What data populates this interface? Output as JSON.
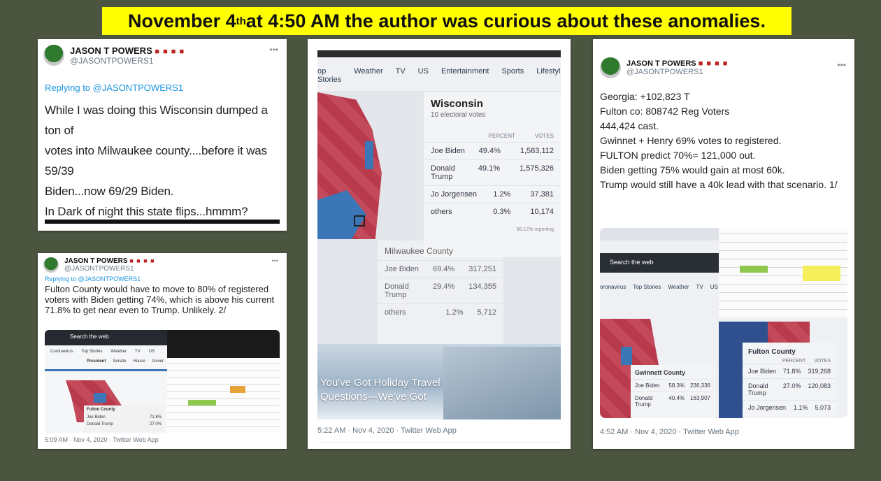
{
  "banner": {
    "pre": "November 4",
    "sup": "th",
    "post": " at 4:50 AM the author was curious about these anomalies."
  },
  "tweet1": {
    "name": "JASON T POWERS",
    "flags": "■ ■ ■ ■",
    "handle": "@JASONTPOWERS1",
    "replying_prefix": "Replying to ",
    "replying_handle": "@JASONTPOWERS1",
    "text_lines": [
      "While I was doing this Wisconsin dumped a ton of",
      "votes into Milwaukee county....before it was 59/39",
      "Biden...now 69/29 Biden.",
      "In Dark of night this state flips...hmmm?"
    ]
  },
  "tweet2": {
    "name": "JASON T POWERS",
    "flags": "■ ■ ■ ■",
    "handle": "@JASONTPOWERS1",
    "replying_prefix": "Replying to ",
    "replying_handle": "@JASONTPOWERS1",
    "text": "Fulton County would have to move to 80% of registered voters with Biden getting 74%, which is above his current 71.8% to get near even to Trump. Unlikely. 2/",
    "meta": "5:09 AM · Nov 4, 2020 · Twitter Web App",
    "shot": {
      "search": "Search the web",
      "nav": [
        "Coronavirus",
        "Top Stories",
        "Weather",
        "TV",
        "US"
      ],
      "subnav": [
        "President",
        "Senate",
        "House",
        "Gover"
      ],
      "fulton": "Fulton County",
      "rows": [
        [
          "Joe Biden",
          "71.8%"
        ],
        [
          "Donald Trump",
          "27.0%"
        ]
      ]
    }
  },
  "tweet3": {
    "meta": "5:22 AM · Nov 4, 2020 · Twitter Web App",
    "nav": [
      "op Stories",
      "Weather",
      "TV",
      "US",
      "Entertainment",
      "Sports",
      "Lifestyle"
    ],
    "state": "Wisconsin",
    "electoral": "10 electoral votes",
    "col_percent": "PERCENT",
    "col_votes": "VOTES",
    "rows": [
      [
        "Joe Biden",
        "49.4%",
        "1,583,112"
      ],
      [
        "Donald Trump",
        "49.1%",
        "1,575,326"
      ],
      [
        "Jo Jorgensen",
        "1.2%",
        "37,381"
      ],
      [
        "others",
        "0.3%",
        "10,174"
      ]
    ],
    "reporting": "96.12% reporting",
    "county": "Milwaukee County",
    "county_rows": [
      [
        "Joe Biden",
        "69.4%",
        "317,251"
      ],
      [
        "Donald Trump",
        "29.4%",
        "134,355"
      ],
      [
        "others",
        "1.2%",
        "5,712"
      ]
    ],
    "promo": [
      "You've Got Holiday Travel",
      "Questions—We've Got"
    ]
  },
  "tweet4": {
    "name": "JASON T POWERS",
    "flags": "■ ■ ■ ■",
    "handle": "@JASONTPOWERS1",
    "lines": [
      "Georgia: +102,823 T",
      "Fulton co: 808742 Reg Voters",
      "444,424 cast.",
      "Gwinnet + Henry 69% votes to registered.",
      "FULTON predict 70%= 121,000 out.",
      "Biden getting 75% would gain at most 60k.",
      "Trump would still have a 40k lead with that scenario. 1/"
    ],
    "meta": "4:52 AM · Nov 4, 2020 · Twitter Web App",
    "shot": {
      "search": "Search the web",
      "nav": [
        "oronavirus",
        "Top Stories",
        "Weather",
        "TV",
        "US"
      ],
      "gwinnett": "Gwinnett County",
      "gw_rows": [
        [
          "Joe Biden",
          "58.3%",
          "236,336"
        ],
        [
          "Donald Trump",
          "40.4%",
          "163,907"
        ]
      ],
      "fulton": "Fulton County",
      "col_percent": "PERCENT",
      "col_votes": "VOTES",
      "fu_rows": [
        [
          "Joe Biden",
          "71.8%",
          "319,268"
        ],
        [
          "Donald Trump",
          "27.0%",
          "120,083"
        ],
        [
          "Jo Jorgensen",
          "1.1%",
          "5,073"
        ]
      ]
    }
  }
}
